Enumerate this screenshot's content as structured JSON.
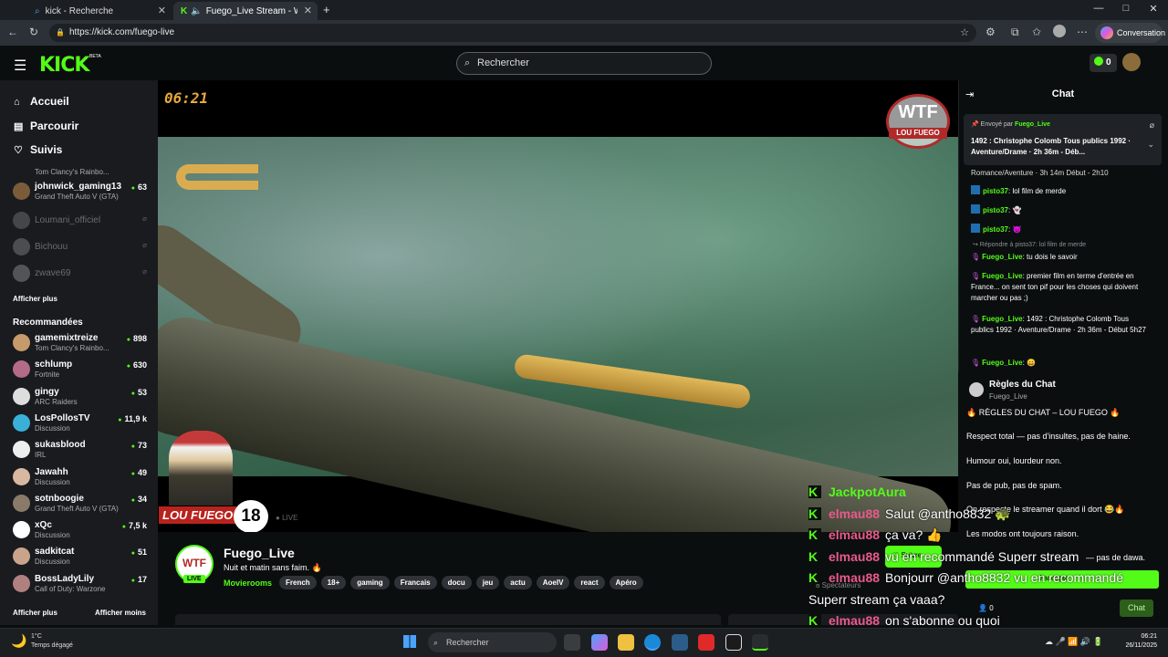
{
  "browser": {
    "tabs": [
      {
        "title": "kick - Recherche",
        "close": "✕"
      },
      {
        "title": "Fuego_Live Stream - Watch Live",
        "close": "✕"
      }
    ],
    "new_tab": "+",
    "url": "https://kick.com/fuego-live",
    "conversation": "Conversation",
    "window_controls": [
      "—",
      "□",
      "✕"
    ]
  },
  "header": {
    "logo": "KICK",
    "beta": "BETA",
    "search_placeholder": "Rechercher",
    "kicks_count": "0"
  },
  "sidebar": {
    "nav": [
      {
        "icon": "home-icon",
        "label": "Accueil"
      },
      {
        "icon": "browse-icon",
        "label": "Parcourir"
      },
      {
        "icon": "heart-icon",
        "label": "Suivis"
      }
    ],
    "followed_partial": "Tom Clancy's Rainbo...",
    "followed": [
      {
        "name": "johnwick_gaming13",
        "game": "Grand Theft Auto V (GTA)",
        "viewers": "63",
        "color": "#7a5c3a"
      },
      {
        "name": "Loumani_officiel",
        "offline": true,
        "color": "#888"
      },
      {
        "name": "Bichouu",
        "offline": true,
        "color": "#999"
      },
      {
        "name": "zwave69",
        "offline": true,
        "color": "#aaa"
      }
    ],
    "show_more": "Afficher plus",
    "recommended_title": "Recommandées",
    "recommended": [
      {
        "name": "gamemixtreize",
        "game": "Tom Clancy's Rainbo...",
        "viewers": "898",
        "color": "#c79a6b"
      },
      {
        "name": "schlump",
        "game": "Fortnite",
        "viewers": "630",
        "color": "#b36b8a"
      },
      {
        "name": "gingy",
        "game": "ARC Raiders",
        "viewers": "53",
        "color": "#ddd"
      },
      {
        "name": "LosPollosTV",
        "game": "Discussion",
        "viewers": "11,9 k",
        "color": "#3ab0d8"
      },
      {
        "name": "sukasblood",
        "game": "IRL",
        "viewers": "73",
        "color": "#eee"
      },
      {
        "name": "Jawahh",
        "game": "Discussion",
        "viewers": "49",
        "color": "#d8b8a0"
      },
      {
        "name": "sotnboogie",
        "game": "Grand Theft Auto V (GTA)",
        "viewers": "34",
        "color": "#8a7a6a"
      },
      {
        "name": "xQc",
        "game": "Discussion",
        "viewers": "7,5 k",
        "color": "#fff"
      },
      {
        "name": "sadkitcat",
        "game": "Discussion",
        "viewers": "51",
        "color": "#c9a48a"
      },
      {
        "name": "BossLadyLily",
        "game": "Call of Duty: Warzone",
        "viewers": "17",
        "color": "#b08080"
      }
    ],
    "show_more2": "Afficher plus",
    "show_less": "Afficher moins"
  },
  "video": {
    "timer": "06:21",
    "wtf_big": "WTF",
    "wtf_small": "LOU FUEGO",
    "age": "18",
    "brand": "LOU FUEGO",
    "live_label": "LIVE"
  },
  "overlay_chat": [
    {
      "user": "JackpotAura",
      "msg": "",
      "style": "green"
    },
    {
      "user": "elmau88",
      "msg": "Salut @antho8832 🐢",
      "style": "pink"
    },
    {
      "user": "elmau88",
      "msg": "ça va? 👍",
      "style": "pink"
    },
    {
      "user": "elmau88",
      "msg": "vu en recommandé Superr stream",
      "style": "pink"
    },
    {
      "user": "elmau88",
      "msg": "Bonjourr @antho8832 vu en recommandé",
      "style": "pink"
    },
    {
      "user": "",
      "msg": "Superr stream ça vaaa?",
      "style": "none"
    },
    {
      "user": "elmau88",
      "msg": "on s'abonne ou quoi",
      "style": "pink"
    },
    {
      "user": "elmau88",
      "msg": "",
      "style": "pink"
    }
  ],
  "channel": {
    "avatar_text": "WTF",
    "live_tag": "LIVE",
    "name": "Fuego_Live",
    "title": "Nuit et matin sans faim. 🔥",
    "category": "Movierooms",
    "tags": [
      "French",
      "18+",
      "gaming",
      "Francais",
      "docu",
      "jeu",
      "actu",
      "AoeIV",
      "react",
      "Apéro"
    ],
    "follow_button": "♡ Suivre",
    "spectators": "8 Spectateurs"
  },
  "chat": {
    "title": "Chat",
    "pinned_by_label": "Envoyé par",
    "pinned_by": "Fuego_Live",
    "pinned_text": "1492 : Christophe Colomb Tous publics 1992 · Aventure/Drame · 2h 36m - Déb...",
    "partial_line": "Romance/Aventure · 3h 14m Début - 2h10",
    "messages": [
      {
        "user": "pisto37",
        "text": ": lol film de merde"
      },
      {
        "user": "pisto37",
        "text": ": 👻"
      },
      {
        "user": "pisto37",
        "text": ": 😈"
      }
    ],
    "reply_to": "↪ Répondre à pisto37: lol film de merde",
    "fuego_messages": [
      {
        "user": "Fuego_Live",
        "text": ": tu dois le savoir"
      },
      {
        "user": "Fuego_Live",
        "text": ": premier film en terme d'entrée en France... on sent ton pif pour les choses qui doivent marcher ou pas ;)"
      },
      {
        "user": "Fuego_Live",
        "text": ": 1492 : Christophe Colomb Tous publics 1992 · Aventure/Drame · 2h 36m - Début 5h27"
      },
      {
        "user": "Fuego_Live",
        "text": ": 😄"
      }
    ],
    "rules_title": "Règles du Chat",
    "rules_sub": "Fuego_Live",
    "rules": [
      "🔥 RÈGLES DU CHAT – LOU FUEGO 🔥",
      "Respect total — pas d'insultes, pas de haine.",
      "Humour oui, lourdeur non.",
      "Pas de pub, pas de spam.",
      "On respecte le streamer quand il dort 😂🔥",
      "Les modos ont toujours raison.",
      "— pas de dawa."
    ],
    "accepted": "J'accepte",
    "viewer_count": "0",
    "send_button": "Chat"
  },
  "taskbar": {
    "weather_temp": "1°C",
    "weather_desc": "Temps dégagé",
    "search": "Rechercher",
    "time": "06:21",
    "date": "26/11/2025"
  }
}
